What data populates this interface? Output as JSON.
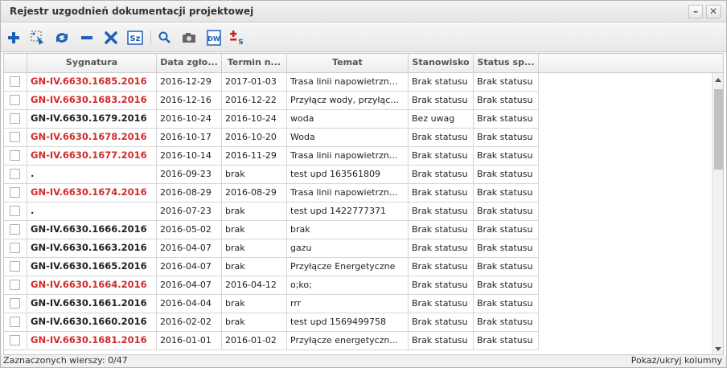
{
  "window": {
    "title": "Rejestr uzgodnień dokumentacji projektowej",
    "minimize_glyph": "–",
    "close_glyph": "✕"
  },
  "toolbar": {
    "icons": [
      "plus-icon",
      "edit-select-icon",
      "refresh-icon",
      "minus-icon",
      "delete-icon",
      "sz-icon",
      "search-icon",
      "camera-icon",
      "dw-icon",
      "plus-minus-s-icon"
    ],
    "sz_label": "Sz",
    "dw_label": "DW",
    "s_label": "S",
    "colors": {
      "blue": "#1c5fb8",
      "red": "#c82020"
    }
  },
  "grid": {
    "columns": [
      "Sygnatura",
      "Data zgło...",
      "Termin n...",
      "Temat",
      "Stanowisko",
      "Status sp..."
    ],
    "rows": [
      {
        "sygnatura": "GN-IV.6630.1685.2016",
        "color": "red",
        "data": "2016-12-29",
        "termin": "2017-01-03",
        "temat": "Trasa linii napowietrzn...",
        "stanowisko": "Brak statusu",
        "status": "Brak statusu"
      },
      {
        "sygnatura": "GN-IV.6630.1683.2016",
        "color": "red",
        "data": "2016-12-16",
        "termin": "2016-12-22",
        "temat": "Przyłącz wody, przyłąc...",
        "stanowisko": "Brak statusu",
        "status": "Brak statusu"
      },
      {
        "sygnatura": "GN-IV.6630.1679.2016",
        "color": "black",
        "data": "2016-10-24",
        "termin": "2016-10-24",
        "temat": "woda",
        "stanowisko": "Bez uwag",
        "status": "Brak statusu"
      },
      {
        "sygnatura": "GN-IV.6630.1678.2016",
        "color": "red",
        "data": "2016-10-17",
        "termin": "2016-10-20",
        "temat": "Woda",
        "stanowisko": "Brak statusu",
        "status": "Brak statusu"
      },
      {
        "sygnatura": "GN-IV.6630.1677.2016",
        "color": "red",
        "data": "2016-10-14",
        "termin": "2016-11-29",
        "temat": "Trasa linii napowietrzn...",
        "stanowisko": "Brak statusu",
        "status": "Brak statusu"
      },
      {
        "sygnatura": ".",
        "color": "black",
        "data": "2016-09-23",
        "termin": "brak",
        "temat": "test upd 163561809",
        "stanowisko": "Brak statusu",
        "status": "Brak statusu"
      },
      {
        "sygnatura": "GN-IV.6630.1674.2016",
        "color": "red",
        "data": "2016-08-29",
        "termin": "2016-08-29",
        "temat": "Trasa linii napowietrzn...",
        "stanowisko": "Brak statusu",
        "status": "Brak statusu"
      },
      {
        "sygnatura": ".",
        "color": "black",
        "data": "2016-07-23",
        "termin": "brak",
        "temat": "test upd 1422777371",
        "stanowisko": "Brak statusu",
        "status": "Brak statusu"
      },
      {
        "sygnatura": "GN-IV.6630.1666.2016",
        "color": "black",
        "data": "2016-05-02",
        "termin": "brak",
        "temat": "brak",
        "stanowisko": "Brak statusu",
        "status": "Brak statusu"
      },
      {
        "sygnatura": "GN-IV.6630.1663.2016",
        "color": "black",
        "data": "2016-04-07",
        "termin": "brak",
        "temat": "gazu",
        "stanowisko": "Brak statusu",
        "status": "Brak statusu"
      },
      {
        "sygnatura": "GN-IV.6630.1665.2016",
        "color": "black",
        "data": "2016-04-07",
        "termin": "brak",
        "temat": "Przyłącze Energetyczne",
        "stanowisko": "Brak statusu",
        "status": "Brak statusu"
      },
      {
        "sygnatura": "GN-IV.6630.1664.2016",
        "color": "red",
        "data": "2016-04-07",
        "termin": "2016-04-12",
        "temat": "o;ko;",
        "stanowisko": "Brak statusu",
        "status": "Brak statusu"
      },
      {
        "sygnatura": "GN-IV.6630.1661.2016",
        "color": "black",
        "data": "2016-04-04",
        "termin": "brak",
        "temat": "rrr",
        "stanowisko": "Brak statusu",
        "status": "Brak statusu"
      },
      {
        "sygnatura": "GN-IV.6630.1660.2016",
        "color": "black",
        "data": "2016-02-02",
        "termin": "brak",
        "temat": "test upd 1569499758",
        "stanowisko": "Brak statusu",
        "status": "Brak statusu"
      },
      {
        "sygnatura": "GN-IV.6630.1681.2016",
        "color": "red",
        "data": "2016-01-01",
        "termin": "2016-01-02",
        "temat": "Przyłącze energetyczn...",
        "stanowisko": "Brak statusu",
        "status": "Brak statusu"
      }
    ]
  },
  "statusbar": {
    "selected": "Zaznaczonych wierszy: 0/47",
    "toggle_columns": "Pokaż/ukryj kolumny"
  }
}
